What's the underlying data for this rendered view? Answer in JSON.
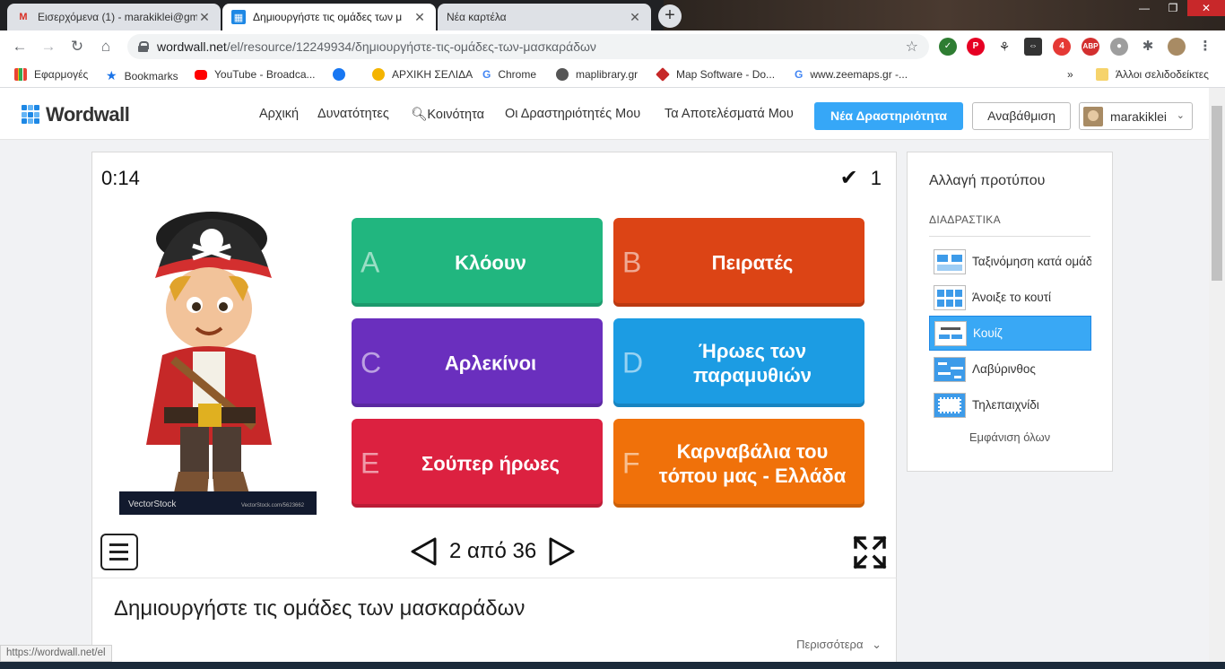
{
  "browser": {
    "tabs": [
      {
        "title": "Εισερχόμενα (1) - marakiklei@gm",
        "icon": "gmail-icon",
        "active": false
      },
      {
        "title": "Δημιουργήστε τις ομάδες των μ",
        "icon": "wordwall-icon",
        "active": true
      },
      {
        "title": "Νέα καρτέλα",
        "icon": "",
        "active": false
      }
    ],
    "url_host": "wordwall.net",
    "url_path": "/el/resource/12249934/δημιουργήστε-τις-ομάδες-των-μασκαράδων",
    "bookmarks": [
      {
        "label": "Εφαρμογές",
        "icon": "apps-grid-icon"
      },
      {
        "label": "Bookmarks",
        "icon": "star-icon"
      },
      {
        "label": "YouTube - Broadca...",
        "icon": "youtube-icon"
      },
      {
        "label": "",
        "icon": "facebook-icon"
      },
      {
        "label": "ΑΡΧΙΚΗ ΣΕΛΙΔΑ",
        "icon": "emoji-icon"
      },
      {
        "label": "Chrome",
        "icon": "google-icon"
      },
      {
        "label": "maplibrary.gr",
        "icon": "globe-icon"
      },
      {
        "label": "Map Software - Do...",
        "icon": "map-software-icon"
      },
      {
        "label": "www.zeemaps.gr -...",
        "icon": "google-icon"
      }
    ],
    "other_bookmarks": "Άλλοι σελιδοδείκτες",
    "status_url": "https://wordwall.net/el"
  },
  "site": {
    "logo": "Wordwall",
    "nav": [
      "Αρχική",
      "Δυνατότητες",
      "Κοινότητα",
      "Οι Δραστηριότητές Μου",
      "Τα Αποτελέσματά Μου"
    ],
    "new_activity": "Νέα Δραστηριότητα",
    "upgrade": "Αναβάθμιση",
    "username": "marakiklei"
  },
  "activity": {
    "timer": "0:14",
    "score": "1",
    "image_watermark": "VectorStock",
    "image_watermark_url": "VectorStock.com/5623662",
    "answers": [
      {
        "letter": "A",
        "label": "Κλόουν",
        "color": "#21b67f"
      },
      {
        "letter": "B",
        "label": "Πειρατές",
        "color": "#dc4415"
      },
      {
        "letter": "C",
        "label": "Αρλεκίνοι",
        "color": "#6a2fbe"
      },
      {
        "letter": "D",
        "label": "Ήρωες των παραμυθιών",
        "color": "#1c9ce3"
      },
      {
        "letter": "E",
        "label": "Σούπερ ήρωες",
        "color": "#dc2140"
      },
      {
        "letter": "F",
        "label": "Καρναβάλια του τόπου μας - Ελλάδα",
        "color": "#f0710a"
      }
    ],
    "page_indicator": "2 από 36"
  },
  "resource_title": "Δημιουργήστε τις ομάδες των μασκαράδων",
  "more_label": "Περισσότερα",
  "sidebar": {
    "heading": "Αλλαγή προτύπου",
    "section": "ΔΙΑΔΡΑΣΤΙΚΑ",
    "templates": [
      {
        "label": "Ταξινόμηση κατά ομάδα",
        "selected": false
      },
      {
        "label": "Άνοιξε το κουτί",
        "selected": false
      },
      {
        "label": "Κουίζ",
        "selected": true
      },
      {
        "label": "Λαβύρινθος",
        "selected": false
      },
      {
        "label": "Τηλεπαιχνίδι",
        "selected": false
      }
    ],
    "show_all": "Εμφάνιση όλων"
  }
}
